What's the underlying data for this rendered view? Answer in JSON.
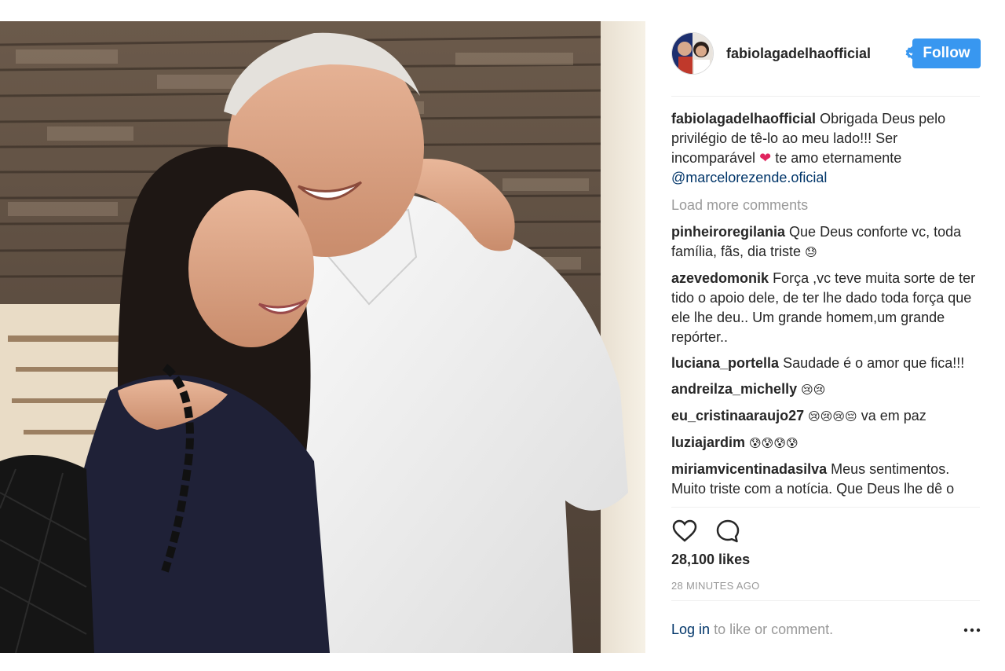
{
  "post": {
    "username": "fabiolagadelhaofficial",
    "follow_label": "Follow",
    "accent_color": "#3897f0",
    "caption": {
      "user": "fabiolagadelhaofficial",
      "text_before": "Obrigada Deus pelo privilégio de tê-lo ao meu lado!!! Ser incomparável",
      "heart": "❤",
      "text_after": "te amo eternamente",
      "mention": "@marcelorezende.oficial"
    },
    "load_more": "Load more comments",
    "comments": [
      {
        "user": "pinheiroregilania",
        "text": "Que Deus conforte vc, toda família, fãs, dia triste",
        "emoji": "😓"
      },
      {
        "user": "azevedomonik",
        "text": "Força ,vc teve muita sorte de ter tido o apoio dele, de ter lhe dado toda força que ele lhe deu.. Um grande homem,um grande repórter..",
        "emoji": ""
      },
      {
        "user": "luciana_portella",
        "text": "Saudade é o amor que fica!!!",
        "emoji": ""
      },
      {
        "user": "andreilza_michelly",
        "text": "",
        "emoji": "😢😢"
      },
      {
        "user": "eu_cristinaaraujo27",
        "text": "",
        "emoji": "😢😢😢😔",
        "text_after": "va em paz"
      },
      {
        "user": "luziajardim",
        "text": "",
        "emoji": "😰😰😰😰"
      },
      {
        "user": "miriamvicentinadasilva",
        "text": "Meus sentimentos. Muito triste com a notícia. Que Deus lhe dê o",
        "emoji": ""
      }
    ],
    "icons": {
      "like": "heart-outline-icon",
      "comment": "comment-bubble-icon",
      "verified": "verified-badge-icon",
      "more": "more-options-icon"
    },
    "likes": "28,100 likes",
    "timestamp": "28 MINUTES AGO",
    "login_link": "Log in",
    "login_suffix": "to like or comment."
  }
}
